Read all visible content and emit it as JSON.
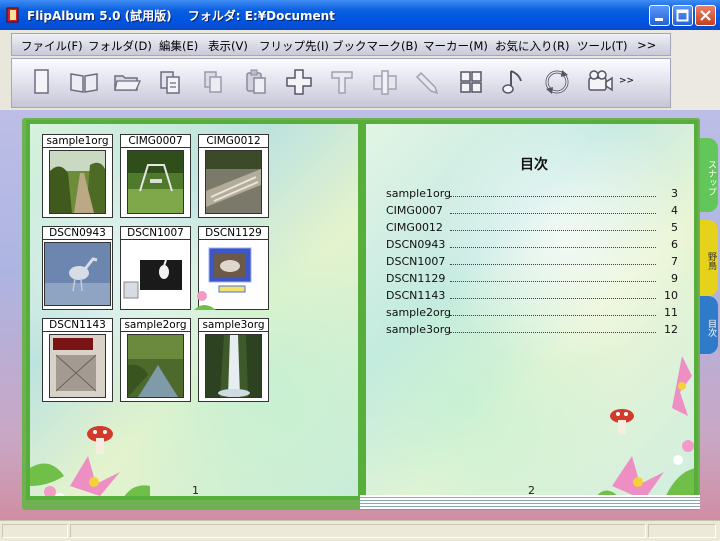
{
  "window": {
    "title": "FlipAlbum 5.0 (試用版)　 フォルダ: E:¥Document"
  },
  "menu": [
    "ファイル(F)",
    "フォルダ(D)",
    "編集(E)",
    "表示(V)",
    "フリップ先(I)",
    "ブックマーク(B)",
    "マーカー(M)",
    "お気に入り(R)",
    "ツール(T)",
    ">>"
  ],
  "toolbar": {
    "icons": [
      "page-icon",
      "open-book-icon",
      "folder-open-icon",
      "copy-page-icon",
      "copy-icon",
      "paste-icon",
      "add-icon",
      "text-icon",
      "frame-icon",
      "pen-icon",
      "grid-icon",
      "music-icon",
      "rotate-icon",
      "video-camera-icon"
    ],
    "more_label": ">>"
  },
  "left_page": {
    "page_number": "1",
    "thumbnails": [
      {
        "caption": "sample1org",
        "icon": "park-path-photo"
      },
      {
        "caption": "CIMG0007",
        "icon": "swing-photo"
      },
      {
        "caption": "CIMG0012",
        "icon": "bench-photo"
      },
      {
        "caption": "DSCN0943",
        "icon": "heron-photo"
      },
      {
        "caption": "DSCN1007",
        "icon": "egret-photo"
      },
      {
        "caption": "DSCN1129",
        "icon": "framed-card-photo"
      },
      {
        "caption": "DSCN1143",
        "icon": "sign-photo"
      },
      {
        "caption": "sample2org",
        "icon": "stream-photo"
      },
      {
        "caption": "sample3org",
        "icon": "waterfall-photo"
      }
    ]
  },
  "right_page": {
    "title": "目次",
    "page_number": "2",
    "toc": [
      {
        "name": "sample1org",
        "page": "3"
      },
      {
        "name": "CIMG0007",
        "page": "4"
      },
      {
        "name": "CIMG0012",
        "page": "5"
      },
      {
        "name": "DSCN0943",
        "page": "6"
      },
      {
        "name": "DSCN1007",
        "page": "7"
      },
      {
        "name": "DSCN1129",
        "page": "9"
      },
      {
        "name": "DSCN1143",
        "page": "10"
      },
      {
        "name": "sample2org",
        "page": "11"
      },
      {
        "name": "sample3org",
        "page": "12"
      }
    ]
  },
  "side_tabs": [
    {
      "label": "スナップ",
      "color": "#62c65a"
    },
    {
      "label": "野鳥",
      "color": "#e6d21a"
    },
    {
      "label": "目次",
      "color": "#2f7bc9"
    }
  ],
  "colors": {
    "title_bar": "#0054e3",
    "book_border": "#58ae3b",
    "desk": "#b3b7e3"
  }
}
